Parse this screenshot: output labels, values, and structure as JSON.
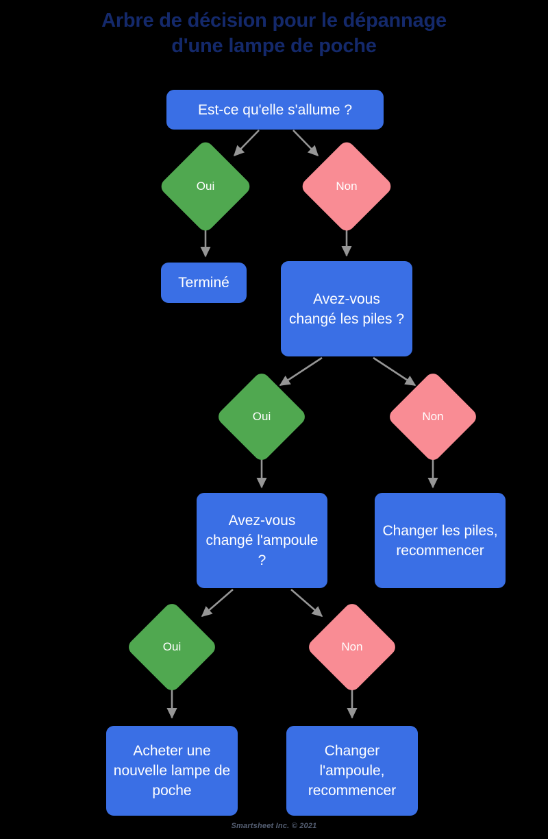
{
  "title": {
    "line1": "Arbre de décision pour le dépannage",
    "line2": "d'une lampe de poche"
  },
  "colors": {
    "background": "#000000",
    "title": "#14296b",
    "process_box": "#3a6fe5",
    "yes_diamond": "#50a850",
    "no_diamond": "#f98c94",
    "connector": "#969696",
    "box_text": "#ffffff",
    "footer_text": "#555f73"
  },
  "nodes": {
    "q1": "Est-ce qu'elle s'allume ?",
    "q1_yes": "Oui",
    "q1_no": "Non",
    "done": "Terminé",
    "q2": "Avez-vous changé les piles ?",
    "q2_yes": "Oui",
    "q2_no": "Non",
    "q3": "Avez-vous changé l'ampoule ?",
    "change_batteries": "Changer les piles, recommencer",
    "q3_yes": "Oui",
    "q3_no": "Non",
    "buy_new": "Acheter une nouvelle lampe de poche",
    "change_bulb": "Changer l'ampoule, recommencer"
  },
  "footer": "Smartsheet Inc. © 2021",
  "chart_data": {
    "type": "diagram",
    "diagram_kind": "decision-tree",
    "title": "Arbre de décision pour le dépannage d'une lampe de poche",
    "nodes": [
      {
        "id": "q1",
        "label": "Est-ce qu'elle s'allume ?",
        "shape": "rounded-rect",
        "color": "#3a6fe5",
        "level": 0
      },
      {
        "id": "q1_yes",
        "label": "Oui",
        "shape": "diamond",
        "color": "#50a850",
        "level": 1
      },
      {
        "id": "q1_no",
        "label": "Non",
        "shape": "diamond",
        "color": "#f98c94",
        "level": 1
      },
      {
        "id": "done",
        "label": "Terminé",
        "shape": "rounded-rect",
        "color": "#3a6fe5",
        "level": 2
      },
      {
        "id": "q2",
        "label": "Avez-vous changé les piles ?",
        "shape": "rounded-rect",
        "color": "#3a6fe5",
        "level": 2
      },
      {
        "id": "q2_yes",
        "label": "Oui",
        "shape": "diamond",
        "color": "#50a850",
        "level": 3
      },
      {
        "id": "q2_no",
        "label": "Non",
        "shape": "diamond",
        "color": "#f98c94",
        "level": 3
      },
      {
        "id": "q3",
        "label": "Avez-vous changé l'ampoule ?",
        "shape": "rounded-rect",
        "color": "#3a6fe5",
        "level": 4
      },
      {
        "id": "change_batteries",
        "label": "Changer les piles, recommencer",
        "shape": "rounded-rect",
        "color": "#3a6fe5",
        "level": 4
      },
      {
        "id": "q3_yes",
        "label": "Oui",
        "shape": "diamond",
        "color": "#50a850",
        "level": 5
      },
      {
        "id": "q3_no",
        "label": "Non",
        "shape": "diamond",
        "color": "#f98c94",
        "level": 5
      },
      {
        "id": "buy_new",
        "label": "Acheter une nouvelle lampe de poche",
        "shape": "rounded-rect",
        "color": "#3a6fe5",
        "level": 6
      },
      {
        "id": "change_bulb",
        "label": "Changer l'ampoule, recommencer",
        "shape": "rounded-rect",
        "color": "#3a6fe5",
        "level": 6
      }
    ],
    "edges": [
      {
        "from": "q1",
        "to": "q1_yes"
      },
      {
        "from": "q1",
        "to": "q1_no"
      },
      {
        "from": "q1_yes",
        "to": "done"
      },
      {
        "from": "q1_no",
        "to": "q2"
      },
      {
        "from": "q2",
        "to": "q2_yes"
      },
      {
        "from": "q2",
        "to": "q2_no"
      },
      {
        "from": "q2_yes",
        "to": "q3"
      },
      {
        "from": "q2_no",
        "to": "change_batteries"
      },
      {
        "from": "q3",
        "to": "q3_yes"
      },
      {
        "from": "q3",
        "to": "q3_no"
      },
      {
        "from": "q3_yes",
        "to": "buy_new"
      },
      {
        "from": "q3_no",
        "to": "change_bulb"
      }
    ]
  }
}
